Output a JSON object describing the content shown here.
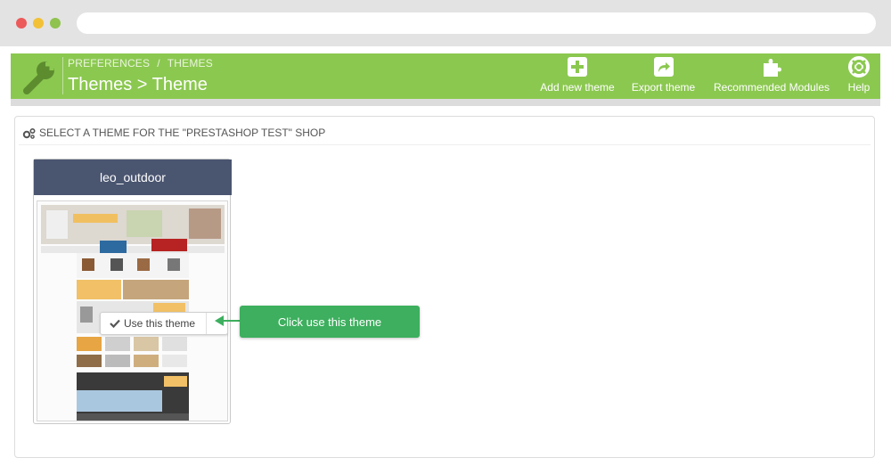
{
  "toolbar": {
    "breadcrumb_parent": "PREFERENCES",
    "breadcrumb_separator": "/",
    "breadcrumb_current": "THEMES",
    "title": "Themes > Theme",
    "buttons": {
      "add": "Add new theme",
      "export": "Export theme",
      "recommended": "Recommended Modules",
      "help": "Help"
    },
    "color": "#8bc850"
  },
  "panel": {
    "heading": "SELECT A THEME FOR THE \"PRESTASHOP TEST\" SHOP"
  },
  "theme_card": {
    "name": "leo_outdoor",
    "use_button_label": "Use this theme",
    "header_color": "#4a5570"
  },
  "callout": {
    "text": "Click use this theme",
    "color": "#3daf5e"
  },
  "icons": [
    "wrench-icon",
    "plus-icon",
    "share-icon",
    "puzzle-icon",
    "lifebuoy-icon",
    "cogs-icon",
    "check-icon"
  ]
}
